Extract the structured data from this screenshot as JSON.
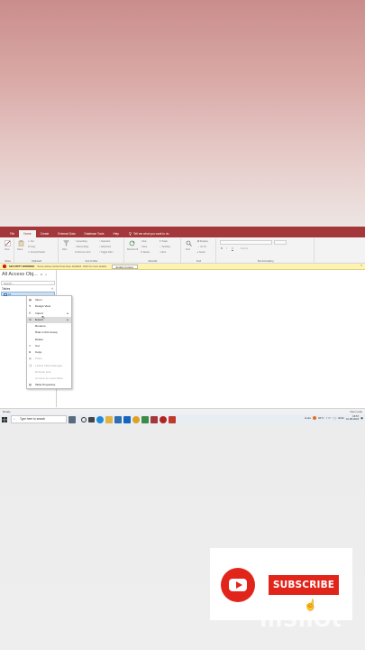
{
  "menu": {
    "tabs": [
      "File",
      "Home",
      "Create",
      "External Data",
      "Database Tools",
      "Help"
    ],
    "active_index": 1,
    "tell_me": "Tell me what you want to do"
  },
  "ribbon": {
    "views_label": "View",
    "paste_label": "Paste",
    "clipboard": [
      "Cut",
      "Copy",
      "Format Painter"
    ],
    "filter_label": "Filter",
    "sort_items": [
      "Ascending",
      "Descending",
      "Remove Sort"
    ],
    "filter_items": [
      "Selection",
      "Advanced",
      "Toggle Filter"
    ],
    "refresh_label": "Refresh All",
    "records_items": [
      "New",
      "Save",
      "Delete"
    ],
    "records_items2": [
      "Totals",
      "Spelling",
      "More"
    ],
    "find_label": "Find",
    "find_items": [
      "Replace",
      "Go To",
      "Select"
    ],
    "format_letters": [
      "B",
      "I",
      "U"
    ],
    "group_labels": [
      "Views",
      "Clipboard",
      "Sort & Filter",
      "Records",
      "Find",
      "Text Formatting"
    ]
  },
  "warning": {
    "title": "SECURITY WARNING",
    "message": "Some active content has been disabled. Click for more details.",
    "button": "Enable Content",
    "close": "×"
  },
  "nav": {
    "title": "All Access Obj...",
    "search_placeholder": "Search...",
    "section": "Tables",
    "table_name": "s1"
  },
  "context_menu": [
    {
      "label": "Open",
      "disabled": false,
      "submenu": false
    },
    {
      "label": "Design View",
      "disabled": false,
      "submenu": false
    },
    {
      "label": "Import",
      "disabled": false,
      "submenu": true
    },
    {
      "label": "Export",
      "disabled": false,
      "submenu": true,
      "hover": true
    },
    {
      "label": "Rename",
      "disabled": false,
      "submenu": false
    },
    {
      "label": "Hide in this Group",
      "disabled": false,
      "submenu": false
    },
    {
      "label": "Delete",
      "disabled": false,
      "submenu": false
    },
    {
      "label": "Cut",
      "disabled": false,
      "submenu": false
    },
    {
      "label": "Copy",
      "disabled": false,
      "submenu": false
    },
    {
      "label": "Paste",
      "disabled": true,
      "submenu": false
    },
    {
      "label": "Linked Table Manager",
      "disabled": true,
      "submenu": false
    },
    {
      "label": "Refresh Link",
      "disabled": true,
      "submenu": false
    },
    {
      "label": "Convert to Local Table",
      "disabled": true,
      "submenu": false
    },
    {
      "label": "Table Properties",
      "disabled": false,
      "submenu": false
    }
  ],
  "status": {
    "left": "Ready",
    "right": "Num Lock"
  },
  "taskbar": {
    "search_placeholder": "Type here to search",
    "weather": "32°C",
    "lang": "ENG",
    "time": "18:57",
    "date": "31-08-2024",
    "links": "Links"
  },
  "overlay": {
    "subscribe": "SUBSCRIBE",
    "watermark": "InShOt"
  },
  "colors": {
    "access_red": "#a4373a",
    "youtube_red": "#e1251b"
  }
}
